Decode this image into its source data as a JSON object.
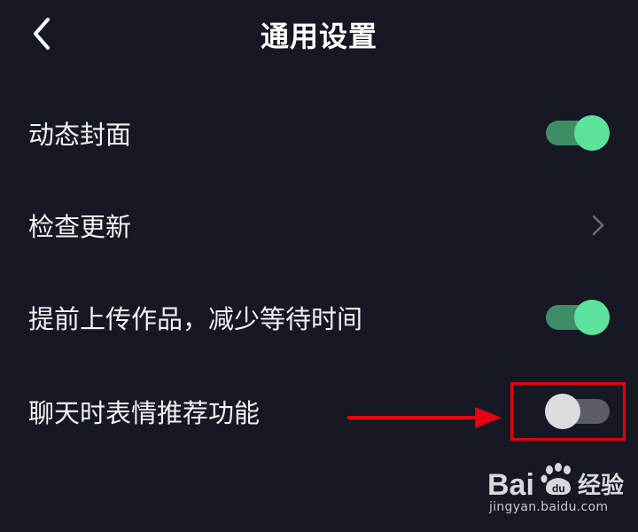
{
  "header": {
    "back_icon": "chevron-left-icon",
    "title": "通用设置"
  },
  "settings": [
    {
      "label": "动态封面",
      "control": "toggle",
      "state": "on"
    },
    {
      "label": "检查更新",
      "control": "chevron",
      "icon": "chevron-right-icon"
    },
    {
      "label": "提前上传作品，减少等待时间",
      "control": "toggle",
      "state": "on"
    },
    {
      "label": "聊天时表情推荐功能",
      "control": "toggle",
      "state": "off"
    }
  ],
  "colors": {
    "background": "#161823",
    "toggle_on_track": "#3f8d66",
    "toggle_on_knob": "#5de29c",
    "toggle_off_track": "#5c5e67",
    "toggle_off_knob": "#dcdcdf",
    "annotation_red": "#e60012"
  },
  "annotation": {
    "arrow_icon": "arrow-right-icon",
    "target": "聊天时表情推荐功能 toggle"
  },
  "watermark": {
    "logo_text": "Bai",
    "logo_suffix": "经验",
    "url": "jingyan.baidu.com"
  }
}
